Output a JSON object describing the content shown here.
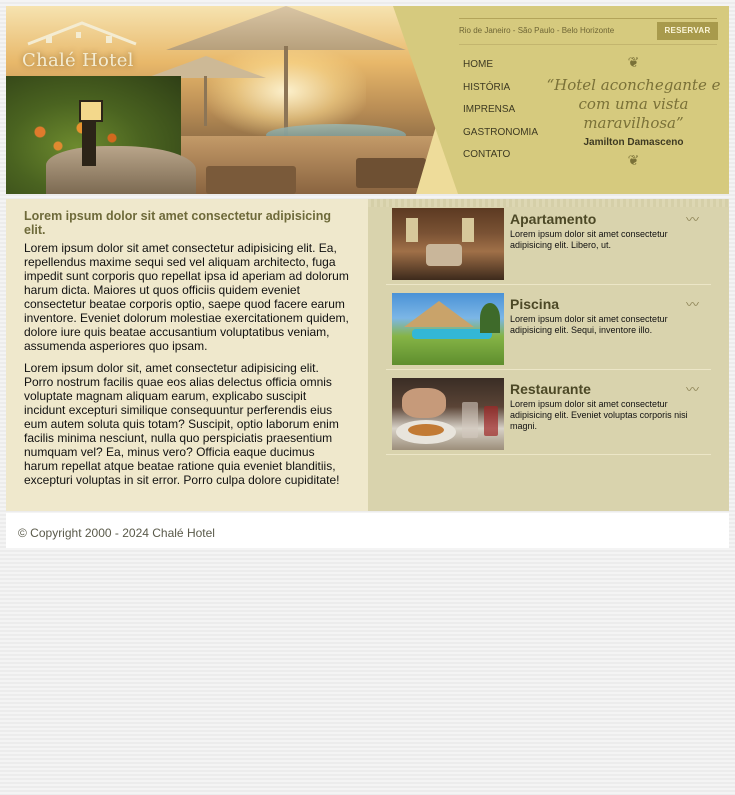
{
  "brand": {
    "logo_text": "Chalé Hotel"
  },
  "header": {
    "cities": "Rio de Janeiro - São Paulo - Belo Horizonte",
    "reserve_label": "RESERVAR"
  },
  "nav": {
    "items": [
      {
        "label": "HOME"
      },
      {
        "label": "HISTÓRIA"
      },
      {
        "label": "IMPRENSA"
      },
      {
        "label": "GASTRONOMIA"
      },
      {
        "label": "CONTATO"
      }
    ]
  },
  "quote": {
    "text": "“Hotel aconchegante e com uma vista maravilhosa”",
    "author": "Jamilton Damasceno"
  },
  "article": {
    "title": "Lorem ipsum dolor sit amet consectetur adipisicing elit.",
    "paragraphs": [
      "Lorem ipsum dolor sit amet consectetur adipisicing elit. Ea, repellendus maxime sequi sed vel aliquam architecto, fuga impedit sunt corporis quo repellat ipsa id aperiam ad dolorum harum dicta. Maiores ut quos officiis quidem eveniet consectetur beatae corporis optio, saepe quod facere earum inventore. Eveniet dolorum molestiae exercitationem quidem, dolore iure quis beatae accusantium voluptatibus veniam, assumenda asperiores quo ipsam.",
      "Lorem ipsum dolor sit, amet consectetur adipisicing elit. Porro nostrum facilis quae eos alias delectus officia omnis voluptate magnam aliquam earum, explicabo suscipit incidunt excepturi similique consequuntur perferendis eius eum autem soluta quis totam? Suscipit, optio laborum enim facilis minima nesciunt, nulla quo perspiciatis praesentium numquam vel? Ea, minus vero? Officia eaque ducimus harum repellat atque beatae ratione quia eveniet blanditiis, excepturi voluptas in sit error. Porro culpa dolore cupiditate!"
    ]
  },
  "rooms": [
    {
      "title": "Apartamento",
      "desc": "Lorem ipsum dolor sit amet consectetur adipisicing elit. Libero, ut."
    },
    {
      "title": "Piscina",
      "desc": "Lorem ipsum dolor sit amet consectetur adipisicing elit. Sequi, inventore illo."
    },
    {
      "title": "Restaurante",
      "desc": "Lorem ipsum dolor sit amet consectetur adipisicing elit. Eveniet voluptas corporis nisi magni."
    }
  ],
  "footer": {
    "copyright": "© Copyright 2000 - 2024 Chalé Hotel"
  },
  "colors": {
    "panel": "#d6ca7e",
    "button": "#a89a4c",
    "heading": "#6e6a3a",
    "content_bg": "#efe8cc",
    "sidebar_bg": "#d9d3ad"
  }
}
